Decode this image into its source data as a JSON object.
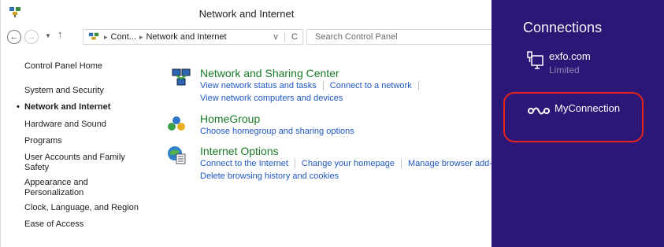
{
  "window": {
    "title": "Network and Internet",
    "address": {
      "crumb_1": "Cont...",
      "crumb_2": "Network and Internet",
      "dropdown_glyph": "v",
      "refresh_glyph": "C"
    },
    "search_placeholder": "Search Control Panel"
  },
  "sidebar": {
    "items": [
      {
        "label": "Control Panel Home"
      },
      {
        "label": "System and Security"
      },
      {
        "label": "Network and Internet",
        "active": true
      },
      {
        "label": "Hardware and Sound"
      },
      {
        "label": "Programs"
      },
      {
        "label": "User Accounts and Family Safety"
      },
      {
        "label": "Appearance and Personalization"
      },
      {
        "label": "Clock, Language, and Region"
      },
      {
        "label": "Ease of Access"
      }
    ]
  },
  "categories": [
    {
      "title": "Network and Sharing Center",
      "icon": "network-sharing-icon",
      "links": [
        "View network status and tasks",
        "Connect to a network",
        "View network computers and devices"
      ]
    },
    {
      "title": "HomeGroup",
      "icon": "homegroup-icon",
      "links": [
        "Choose homegroup and sharing options"
      ]
    },
    {
      "title": "Internet Options",
      "icon": "internet-options-icon",
      "links": [
        "Connect to the Internet",
        "Change your homepage",
        "Manage browser add-",
        "Delete browsing history and cookies"
      ]
    }
  ],
  "connections_panel": {
    "title": "Connections",
    "connections": [
      {
        "name": "exfo.com",
        "status": "Limited",
        "icon": "ethernet-icon"
      },
      {
        "name": "MyConnection",
        "icon": "vpn-icon",
        "highlighted": true
      }
    ]
  },
  "colors": {
    "panel_bg": "#2c1776",
    "link": "#1f57c2",
    "category_title": "#1a7a28",
    "highlight": "#e3231e"
  }
}
